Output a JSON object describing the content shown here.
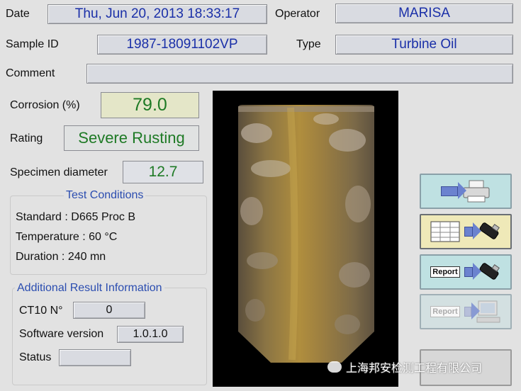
{
  "header": {
    "date_label": "Date",
    "date_value": "Thu, Jun 20, 2013  18:33:17",
    "operator_label": "Operator",
    "operator_value": "MARISA",
    "sample_label": "Sample ID",
    "sample_value": "1987-18091102VP",
    "type_label": "Type",
    "type_value": "Turbine Oil",
    "comment_label": "Comment",
    "comment_value": ""
  },
  "results": {
    "corrosion_label": "Corrosion (%)",
    "corrosion_value": "79.0",
    "rating_label": "Rating",
    "rating_value": "Severe Rusting",
    "diameter_label": "Specimen diameter",
    "diameter_value": "12.7"
  },
  "test_conditions": {
    "title": "Test Conditions",
    "standard": "Standard : D665 Proc B",
    "temperature": "Temperature : 60 °C",
    "duration": "Duration : 240 mn"
  },
  "additional": {
    "title": "Additional Result Information",
    "ct10_label": "CT10 N°",
    "ct10_value": "0",
    "software_label": "Software version",
    "software_value": "1.0.1.0",
    "status_label": "Status",
    "status_value": ""
  },
  "buttons": {
    "report_text": "Report",
    "report_text_disabled": "Report"
  },
  "watermark": "上海邦安检测工程有限公司",
  "colors": {
    "field_text": "#1a2fa8",
    "highlight_text": "#1e7a25",
    "group_title": "#2b4db0"
  }
}
